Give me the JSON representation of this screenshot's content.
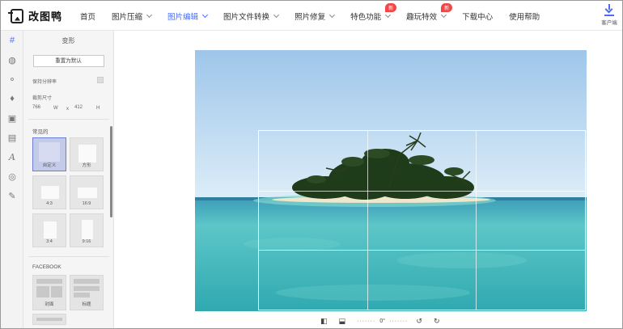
{
  "app": {
    "name": "改图鸭"
  },
  "nav": {
    "items": [
      {
        "label": "首页"
      },
      {
        "label": "图片压缩"
      },
      {
        "label": "图片编辑"
      },
      {
        "label": "图片文件转换"
      },
      {
        "label": "照片修复"
      },
      {
        "label": "特色功能",
        "badge": "新"
      },
      {
        "label": "趣玩特效",
        "badge": "新"
      },
      {
        "label": "下载中心"
      },
      {
        "label": "使用帮助"
      }
    ],
    "client_label": "客户端"
  },
  "panel": {
    "title": "变形",
    "reset_label": "重置为默认",
    "keep_ratio_label": "保持分辨率",
    "crop_size_label": "裁剪尺寸",
    "width_value": "766",
    "width_unit": "W",
    "times": "x",
    "height_value": "412",
    "height_unit": "H",
    "common_label": "常见的",
    "presets": [
      {
        "label": "自定义"
      },
      {
        "label": "方形"
      },
      {
        "label": "4:3"
      },
      {
        "label": "16:9"
      },
      {
        "label": "3:4"
      },
      {
        "label": "9:16"
      }
    ],
    "facebook_label": "FACEBOOK",
    "facebook_presets": [
      {
        "label": "封面"
      },
      {
        "label": "标题"
      }
    ]
  },
  "toolbar": {
    "angle": "0°"
  },
  "colors": {
    "accent": "#4a6cf7",
    "badge": "#f04848"
  }
}
